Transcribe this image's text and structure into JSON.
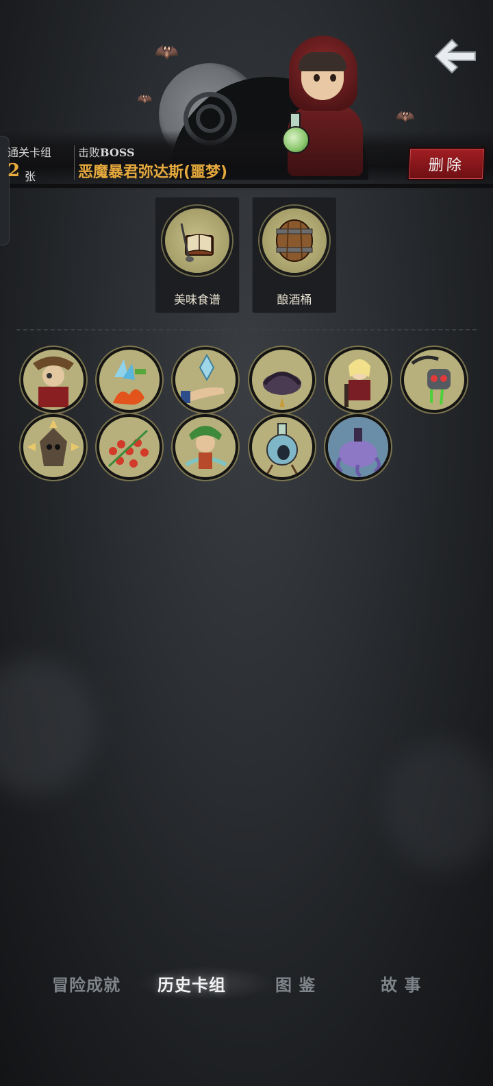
{
  "header": {
    "clear_deck_label": "通关卡组",
    "clear_deck_count": "2",
    "clear_deck_unit": "张",
    "defeat_label_prefix": "击败",
    "defeat_label_suffix": "BOSS",
    "boss_name": "恶魔暴君弥达斯(噩梦)",
    "delete_label": "删除",
    "back_icon": "back-arrow-icon"
  },
  "relics": [
    {
      "label": "美味食谱",
      "icon": "recipe-book-icon"
    },
    {
      "label": "酿酒桶",
      "icon": "barrel-icon"
    }
  ],
  "cards": [
    {
      "icon": "card-captain-icon"
    },
    {
      "icon": "card-ice-fire-icon"
    },
    {
      "icon": "card-crystal-hand-icon"
    },
    {
      "icon": "card-nest-icon"
    },
    {
      "icon": "card-girl-chair-icon"
    },
    {
      "icon": "card-skull-scythe-icon"
    },
    {
      "icon": "card-skull-spikes-icon"
    },
    {
      "icon": "card-beads-icon"
    },
    {
      "icon": "card-dryad-icon"
    },
    {
      "icon": "card-bottle-bird-icon"
    },
    {
      "icon": "card-tentacle-icon"
    }
  ],
  "bottom_nav": {
    "tabs": [
      "冒险成就",
      "历史卡组",
      "图 鉴",
      "故 事"
    ],
    "active_index": 1
  },
  "colors": {
    "accent_gold": "#e6a93d",
    "delete_red": "#a11e22",
    "card_bg": "#b8b07c"
  }
}
